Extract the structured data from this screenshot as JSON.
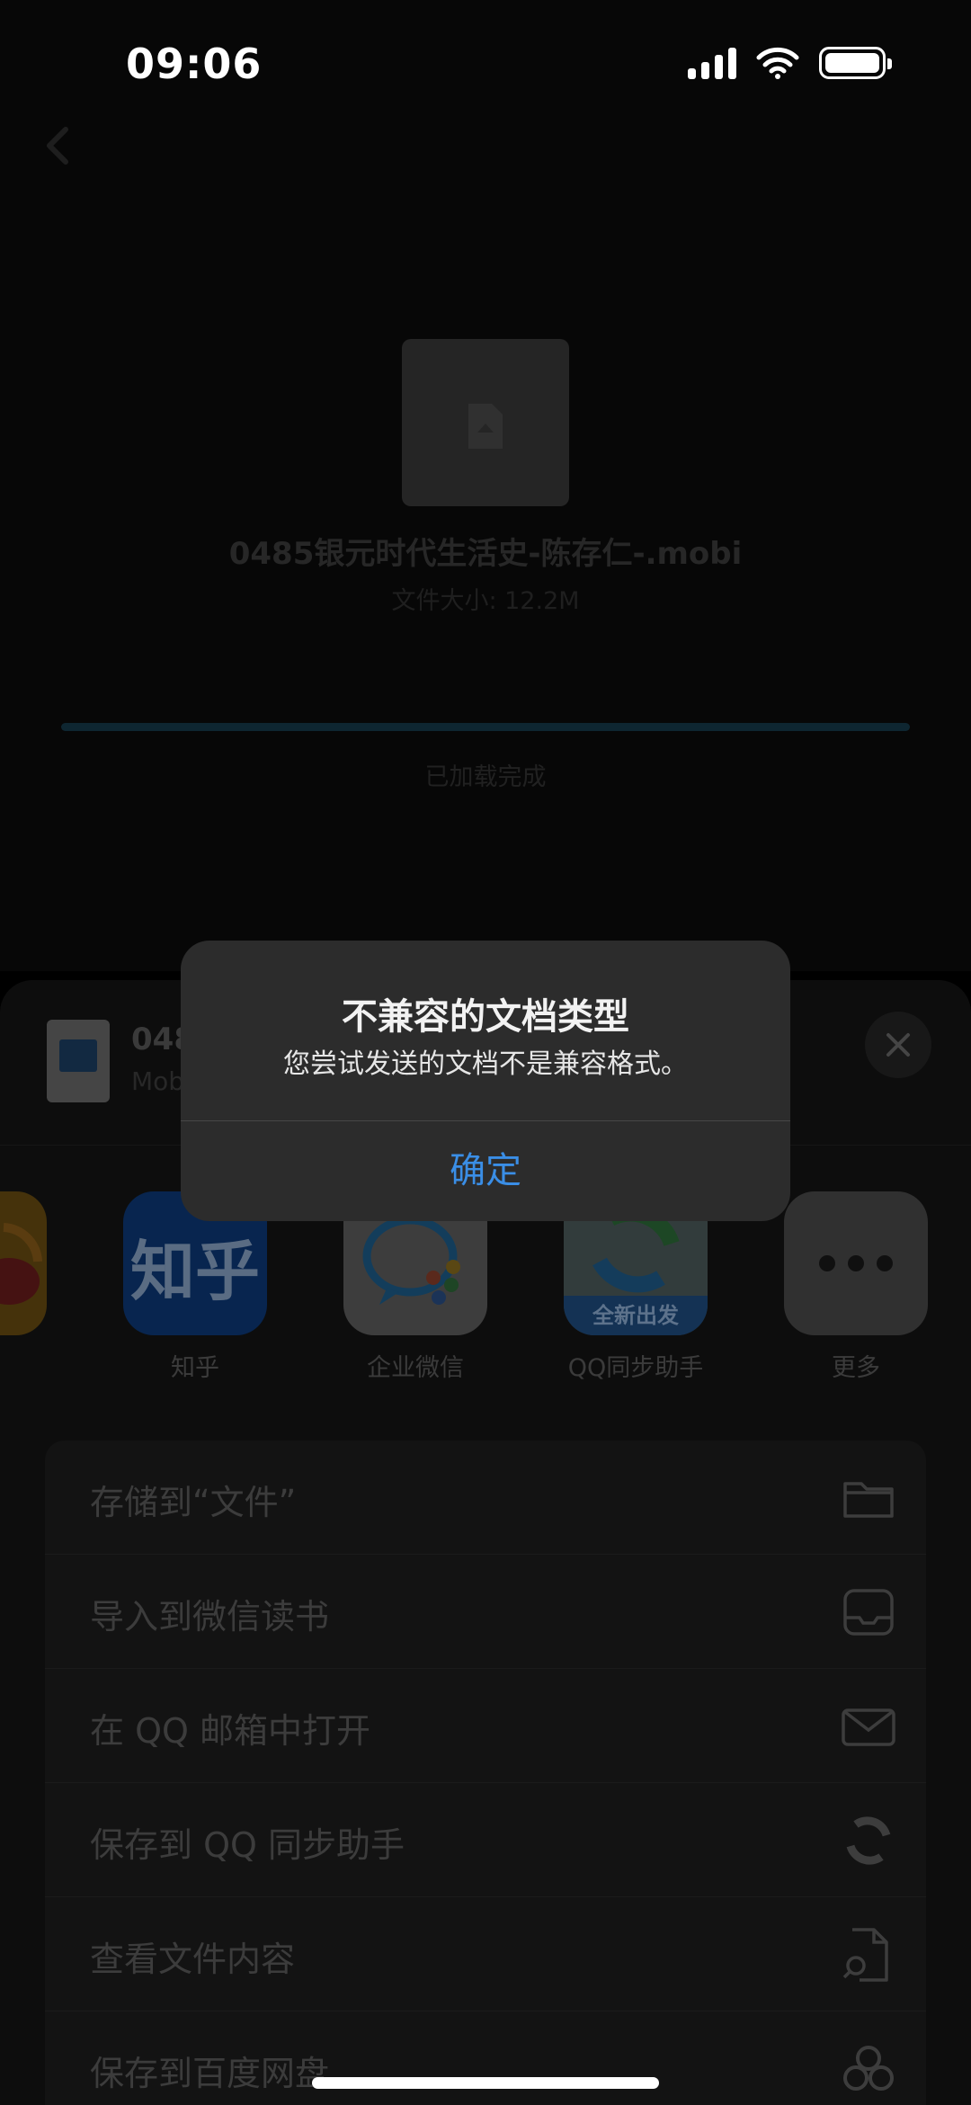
{
  "status_bar": {
    "time": "09:06"
  },
  "file": {
    "name": "0485银元时代生活史-陈存仁-.mobi",
    "size": "文件大小: 12.2M",
    "progress": 1.0,
    "status": "已加载完成"
  },
  "share_sheet": {
    "title": "048",
    "subtitle": "Mob",
    "apps": [
      {
        "label": "知乎",
        "icon_text": "知乎"
      },
      {
        "label": "企业微信"
      },
      {
        "label": "QQ同步助手",
        "icon_text": "全新出发"
      },
      {
        "label": "更多"
      }
    ],
    "actions": [
      {
        "label": "存储到“文件”",
        "icon": "folder-icon"
      },
      {
        "label": "导入到微信读书",
        "icon": "tray-icon"
      },
      {
        "label": "在 QQ 邮箱中打开",
        "icon": "mail-icon"
      },
      {
        "label": "保存到 QQ 同步助手",
        "icon": "sync-icon"
      },
      {
        "label": "查看文件内容",
        "icon": "document-search-icon"
      },
      {
        "label": "保存到百度网盘",
        "icon": "baidu-cloud-icon"
      }
    ]
  },
  "alert": {
    "title": "不兼容的文档类型",
    "message": "您尝试发送的文档不是兼容格式。",
    "confirm": "确定"
  },
  "colors": {
    "accent": "#3a8ee6",
    "alert_bg": "#2c2c2c"
  }
}
